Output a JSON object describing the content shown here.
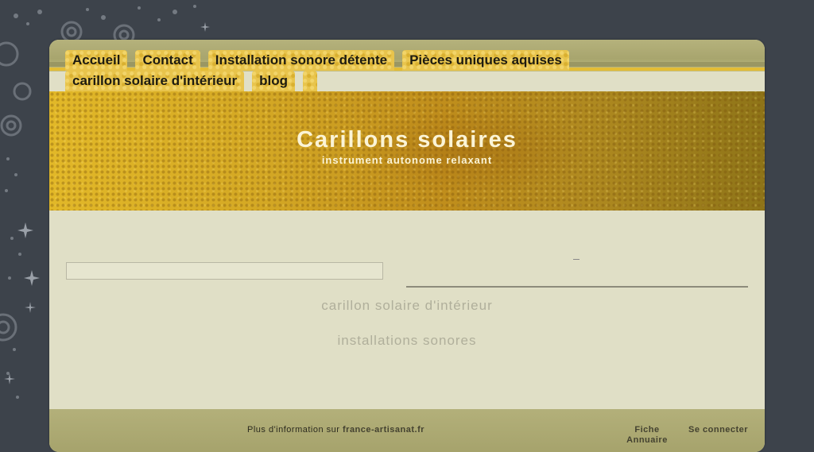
{
  "nav": {
    "row1": [
      "Accueil",
      "Contact",
      "Installation sonore détente",
      "Pièces uniques aquises"
    ],
    "row2": [
      "carillon solaire d'intérieur",
      "blog"
    ]
  },
  "banner": {
    "title": "Carillons solaires",
    "subtitle": "instrument autonome relaxant"
  },
  "content": {
    "link1": "carillon solaire d'intérieur",
    "link2": "installations sonores"
  },
  "footer": {
    "info_prefix": "Plus d'information sur",
    "info_site": "france-artisanat.fr",
    "fiche_line1": "Fiche",
    "fiche_line2": "Annuaire",
    "connect": "Se connecter"
  },
  "colors": {
    "page_bg": "#3d434b",
    "content_bg": "#e0dfc6",
    "gold": "#e4bd35",
    "title_text": "#fbf4d6"
  }
}
